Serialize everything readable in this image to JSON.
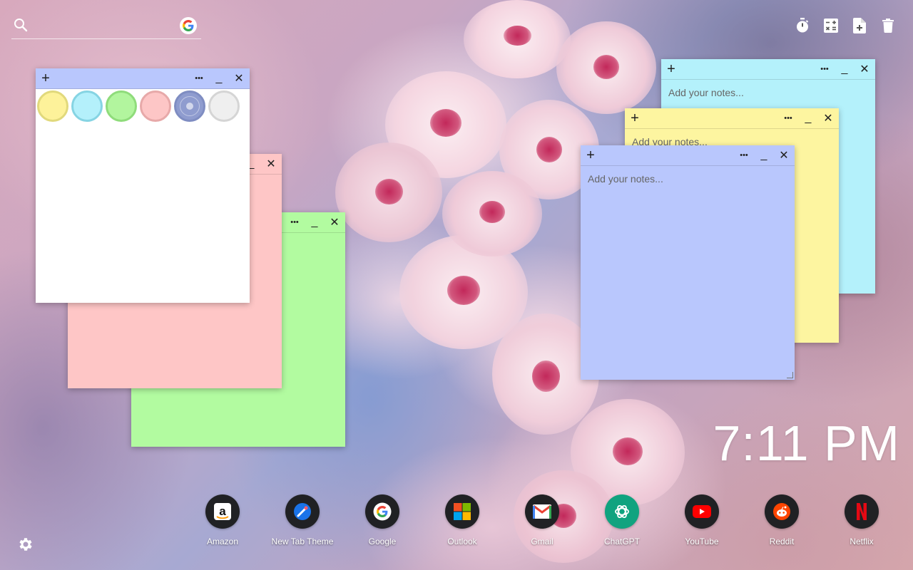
{
  "search": {
    "icon": "search-icon",
    "engine_icon": "google-icon"
  },
  "toolbar": [
    {
      "name": "timer-icon",
      "label": "Timer"
    },
    {
      "name": "calculator-icon",
      "label": "Calculator"
    },
    {
      "name": "new-note-icon",
      "label": "Add note"
    },
    {
      "name": "trash-icon",
      "label": "Delete"
    }
  ],
  "note_controls": {
    "add": "+",
    "more": "•••",
    "minimize": "_",
    "close": "✕"
  },
  "notes": {
    "placeholder": "Add your notes...",
    "colors": {
      "yellow": "#fdf5a0",
      "cyan": "#b4f1fb",
      "green": "#b2fba0",
      "pink": "#fec6c6",
      "lavender": "#b9c7fd",
      "white": "#ffffff"
    }
  },
  "palette": [
    {
      "name": "yellow-swatch",
      "fill": "#fdf29a",
      "border": "#e1d97c"
    },
    {
      "name": "cyan-swatch",
      "fill": "#b4f0fb",
      "border": "#86d4e3"
    },
    {
      "name": "green-swatch",
      "fill": "#b2f59e",
      "border": "#8fdc7b"
    },
    {
      "name": "pink-swatch",
      "fill": "#fdc6c6",
      "border": "#e7a9a9"
    },
    {
      "name": "lavender-swatch",
      "fill": "#8f9ccf",
      "border": "#7f8dc2",
      "selected": true
    },
    {
      "name": "white-swatch",
      "fill": "#efefef",
      "border": "#d5d5d5"
    }
  ],
  "clock": {
    "time": "7:11 PM"
  },
  "dock": [
    {
      "label": "Amazon",
      "icon": "amazon-icon"
    },
    {
      "label": "New Tab Theme",
      "icon": "new-tab-theme-icon"
    },
    {
      "label": "Google",
      "icon": "google-icon"
    },
    {
      "label": "Outlook",
      "icon": "microsoft-icon"
    },
    {
      "label": "Gmail",
      "icon": "gmail-icon"
    },
    {
      "label": "ChatGPT",
      "icon": "chatgpt-icon"
    },
    {
      "label": "YouTube",
      "icon": "youtube-icon"
    },
    {
      "label": "Reddit",
      "icon": "reddit-icon"
    },
    {
      "label": "Netflix",
      "icon": "netflix-icon"
    }
  ],
  "settings": {
    "icon": "gear-icon"
  }
}
